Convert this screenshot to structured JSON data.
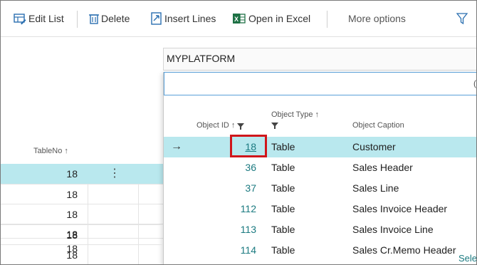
{
  "toolbar": {
    "edit_list": "Edit List",
    "delete": "Delete",
    "insert_lines": "Insert Lines",
    "open_in_excel": "Open in Excel",
    "more_options": "More options"
  },
  "left_list": {
    "header": "TableNo ↑",
    "rows": [
      "18",
      "18",
      "18",
      "18",
      "18",
      "18",
      "18"
    ]
  },
  "lookup": {
    "value": "MYPLATFORM",
    "search_peek": "(",
    "columns": {
      "object_id": "Object ID ↑",
      "object_type": "Object Type ↑",
      "object_caption": "Object Caption"
    },
    "rows": [
      {
        "id": "18",
        "type": "Table",
        "caption": "Customer"
      },
      {
        "id": "36",
        "type": "Table",
        "caption": "Sales Header"
      },
      {
        "id": "37",
        "type": "Table",
        "caption": "Sales Line"
      },
      {
        "id": "112",
        "type": "Table",
        "caption": "Sales Invoice Header"
      },
      {
        "id": "113",
        "type": "Table",
        "caption": "Sales Invoice Line"
      },
      {
        "id": "114",
        "type": "Table",
        "caption": "Sales Cr.Memo Header"
      }
    ],
    "selection_arrow": "→",
    "footer_text": "Sele"
  },
  "colors": {
    "accent": "#1b7a80",
    "selection": "#b9e8ee",
    "highlight": "#d0161b"
  }
}
